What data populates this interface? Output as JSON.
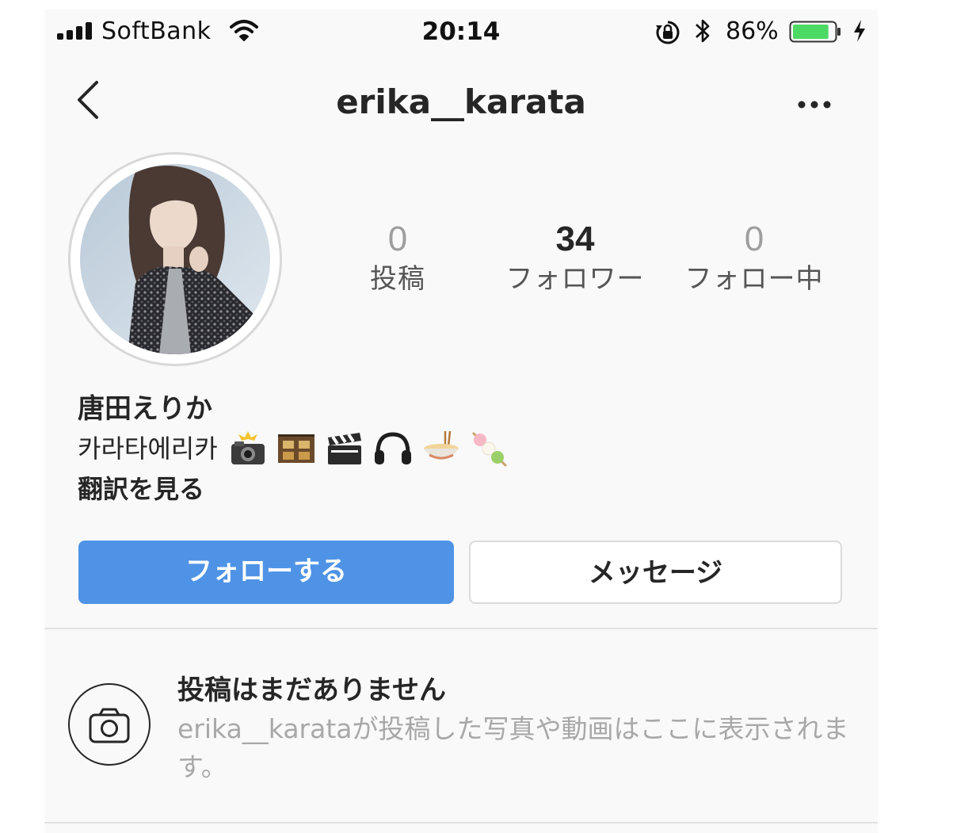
{
  "status_bar": {
    "carrier": "SoftBank",
    "time": "20:14",
    "battery_percent": "86%",
    "battery_level": 0.86,
    "battery_color": "#4cd964",
    "icons": [
      "signal-icon",
      "wifi-icon",
      "rotation-lock-icon",
      "bluetooth-icon",
      "battery-icon",
      "charging-icon"
    ]
  },
  "nav": {
    "username": "erika__karata",
    "back_icon": "chevron-left-icon",
    "more_icon": "more-horizontal-icon"
  },
  "profile": {
    "stats": [
      {
        "value": "0",
        "label": "投稿"
      },
      {
        "value": "34",
        "label": "フォロワー"
      },
      {
        "value": "0",
        "label": "フォロー中"
      }
    ],
    "name": "唐田えりか",
    "bio_text": "카라타에리카",
    "bio_emojis": [
      "camera-flash-icon",
      "film-frames-icon",
      "clapper-board-icon",
      "headphones-icon",
      "noodle-bowl-icon",
      "dango-icon"
    ],
    "translate_label": "翻訳を見る"
  },
  "actions": {
    "follow_label": "フォローする",
    "message_label": "メッセージ",
    "follow_color": "#4f93e6"
  },
  "empty_state": {
    "title": "投稿はまだありません",
    "description": "erika__karataが投稿した写真や動画はここに表示されます。",
    "icon": "camera-outline-icon"
  }
}
